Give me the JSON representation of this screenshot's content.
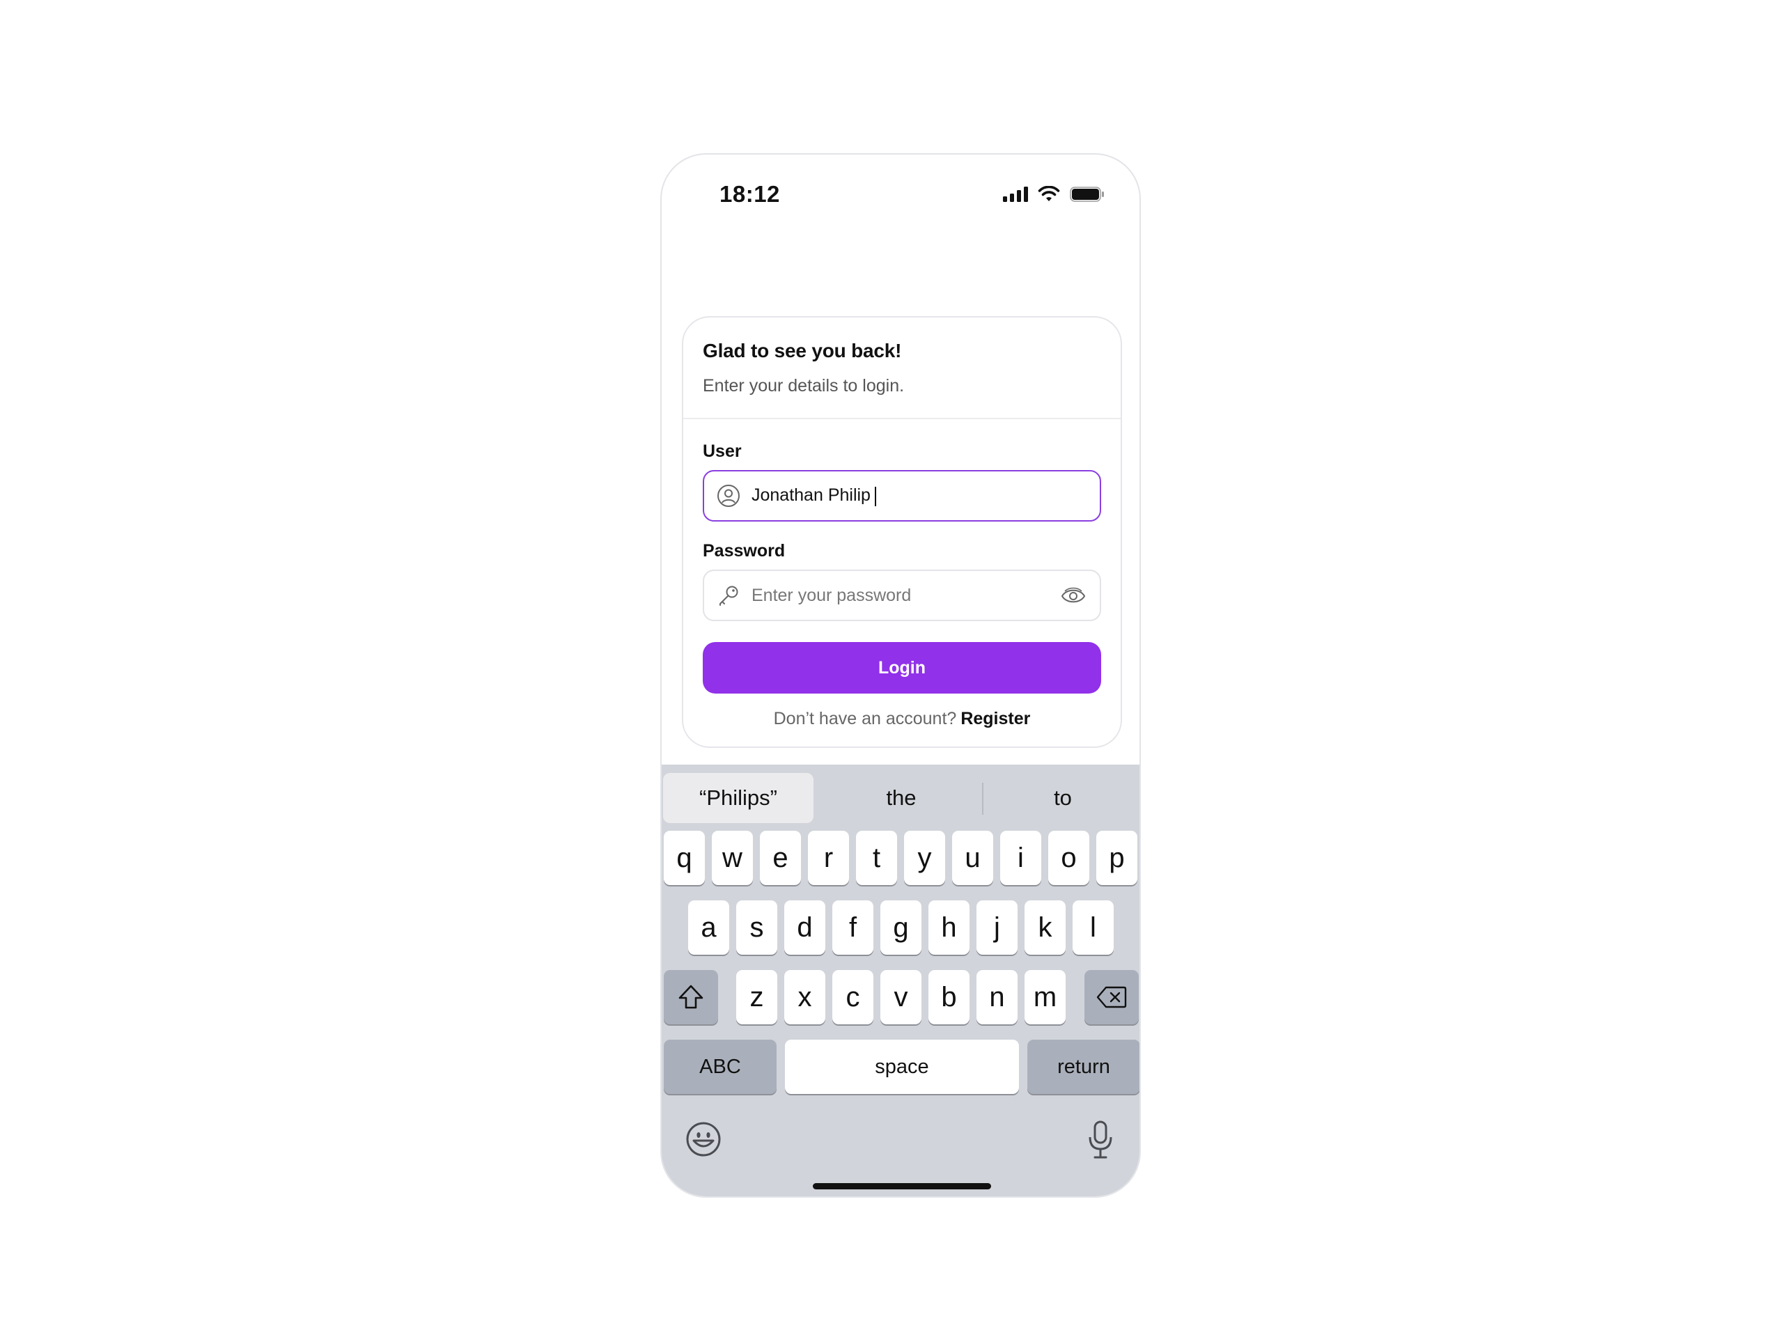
{
  "status_bar": {
    "time": "18:12",
    "icons": [
      "cellular-signal-icon",
      "wifi-icon",
      "battery-icon"
    ]
  },
  "login_card": {
    "title": "Glad to see you back!",
    "subtitle": "Enter your details to login.",
    "user_field": {
      "label": "User",
      "value": "Jonathan Philip",
      "icon": "user-circle-icon"
    },
    "password_field": {
      "label": "Password",
      "placeholder": "Enter your password",
      "icon": "key-icon",
      "toggle_icon": "eye-icon"
    },
    "login_button": "Login",
    "register_prompt": "Don’t have an account?",
    "register_link": "Register"
  },
  "keyboard": {
    "suggestions": [
      "“Philips”",
      "the",
      "to"
    ],
    "row1": [
      "q",
      "w",
      "e",
      "r",
      "t",
      "y",
      "u",
      "i",
      "o",
      "p"
    ],
    "row2": [
      "a",
      "s",
      "d",
      "f",
      "g",
      "h",
      "j",
      "k",
      "l"
    ],
    "row3": [
      "z",
      "x",
      "c",
      "v",
      "b",
      "n",
      "m"
    ],
    "abc_key": "ABC",
    "space_key": "space",
    "return_key": "return",
    "icons": [
      "shift-icon",
      "backspace-icon",
      "emoji-icon",
      "microphone-icon"
    ]
  },
  "colors": {
    "accent": "#9131ea",
    "focus_border": "#8a3fe0",
    "keyboard_bg": "#d1d4da",
    "dark_key": "#aab0bb"
  }
}
